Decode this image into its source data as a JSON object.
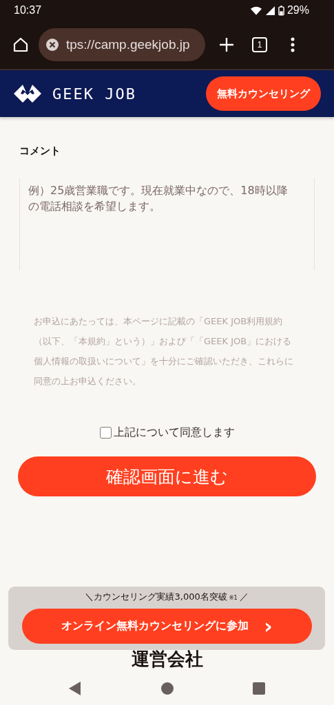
{
  "status_bar": {
    "time": "10:37",
    "battery": "29%"
  },
  "browser": {
    "url": "tps://camp.geekjob.jp",
    "tab_count": "1"
  },
  "header": {
    "logo": "GEEK JOB",
    "cta": "無料カウンセリング"
  },
  "form": {
    "comment_label": "コメント",
    "comment_field": {
      "placeholder": "例）25歳営業職です。現在就業中なので、18時以降の電話相談を希望します。"
    },
    "notice": "お申込にあたっては、本ページに記載の「GEEK JOB利用規約（以下、「本規約」という）」および「「GEEK JOB」における個人情報の取扱いについて」を十分にご確認いただき、これらに同意の上お申込ください。",
    "agree": {
      "label": "上記について同意します",
      "checked": false
    },
    "submit": "確認画面に進む"
  },
  "section_heading": "運営会社",
  "floating_panel": {
    "tagline_left": "＼",
    "tagline": "カウンセリング実績3,000名突破",
    "footnote": "※1",
    "tagline_right": "／",
    "button": "オンライン無料カウンセリングに参加",
    "button_icon": "›"
  }
}
